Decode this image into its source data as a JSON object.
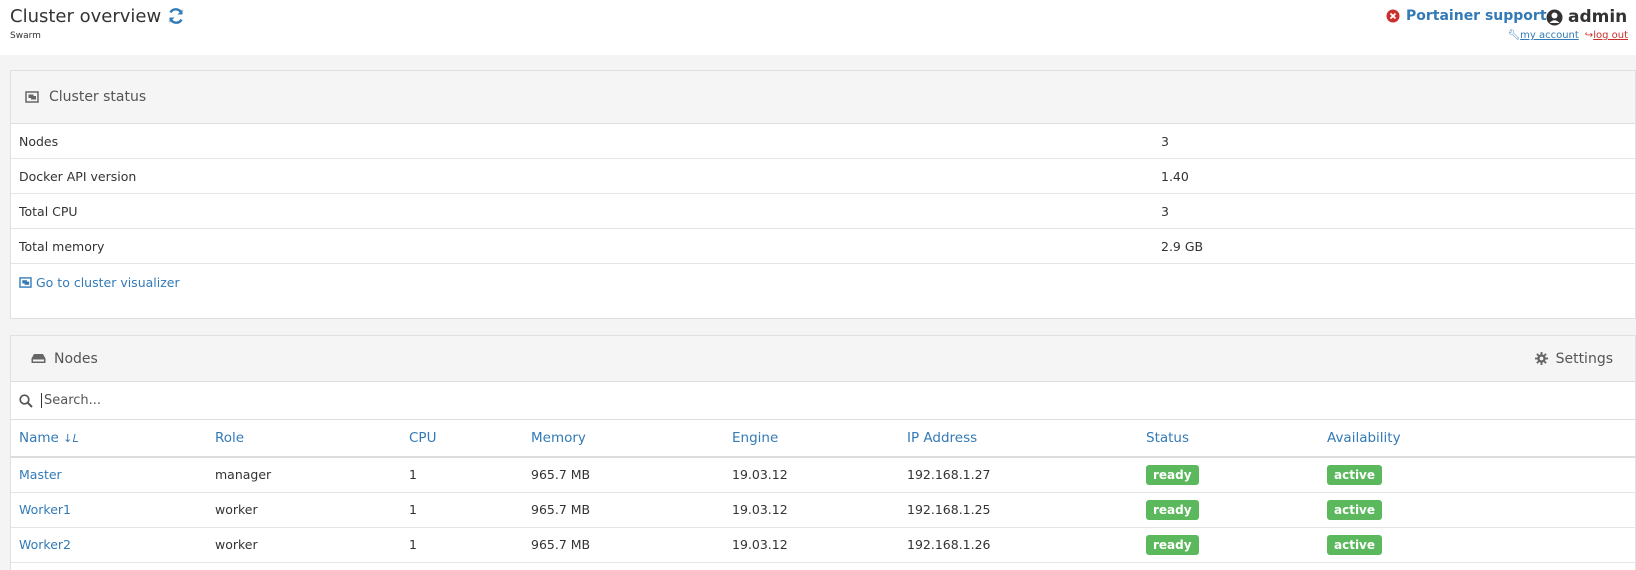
{
  "header": {
    "title": "Cluster overview",
    "subtitle": "Swarm",
    "support_label": "Portainer support",
    "user": "admin",
    "my_account": "my account",
    "log_out": "log out"
  },
  "cluster_status": {
    "heading": "Cluster status",
    "rows": [
      {
        "key": "Nodes",
        "value": "3"
      },
      {
        "key": "Docker API version",
        "value": "1.40"
      },
      {
        "key": "Total CPU",
        "value": "3"
      },
      {
        "key": "Total memory",
        "value": "2.9 GB"
      }
    ],
    "visualizer_link": "Go to cluster visualizer"
  },
  "nodes": {
    "heading": "Nodes",
    "settings_label": "Settings",
    "search_placeholder": "Search...",
    "columns": [
      "Name",
      "Role",
      "CPU",
      "Memory",
      "Engine",
      "IP Address",
      "Status",
      "Availability"
    ],
    "rows": [
      {
        "name": "Master",
        "role": "manager",
        "cpu": "1",
        "memory": "965.7 MB",
        "engine": "19.03.12",
        "ip": "192.168.1.27",
        "status": "ready",
        "availability": "active"
      },
      {
        "name": "Worker1",
        "role": "worker",
        "cpu": "1",
        "memory": "965.7 MB",
        "engine": "19.03.12",
        "ip": "192.168.1.25",
        "status": "ready",
        "availability": "active"
      },
      {
        "name": "Worker2",
        "role": "worker",
        "cpu": "1",
        "memory": "965.7 MB",
        "engine": "19.03.12",
        "ip": "192.168.1.26",
        "status": "ready",
        "availability": "active"
      }
    ]
  },
  "colors": {
    "link": "#337ab7",
    "success": "#5cb85c",
    "danger": "#c9302c"
  },
  "icons": [
    "refresh-icon",
    "times-circle-icon",
    "user-circle-icon",
    "wrench-icon",
    "sign-out-icon",
    "object-group-icon",
    "hdd-icon",
    "cog-icon",
    "search-icon",
    "sort-alpha-icon"
  ]
}
